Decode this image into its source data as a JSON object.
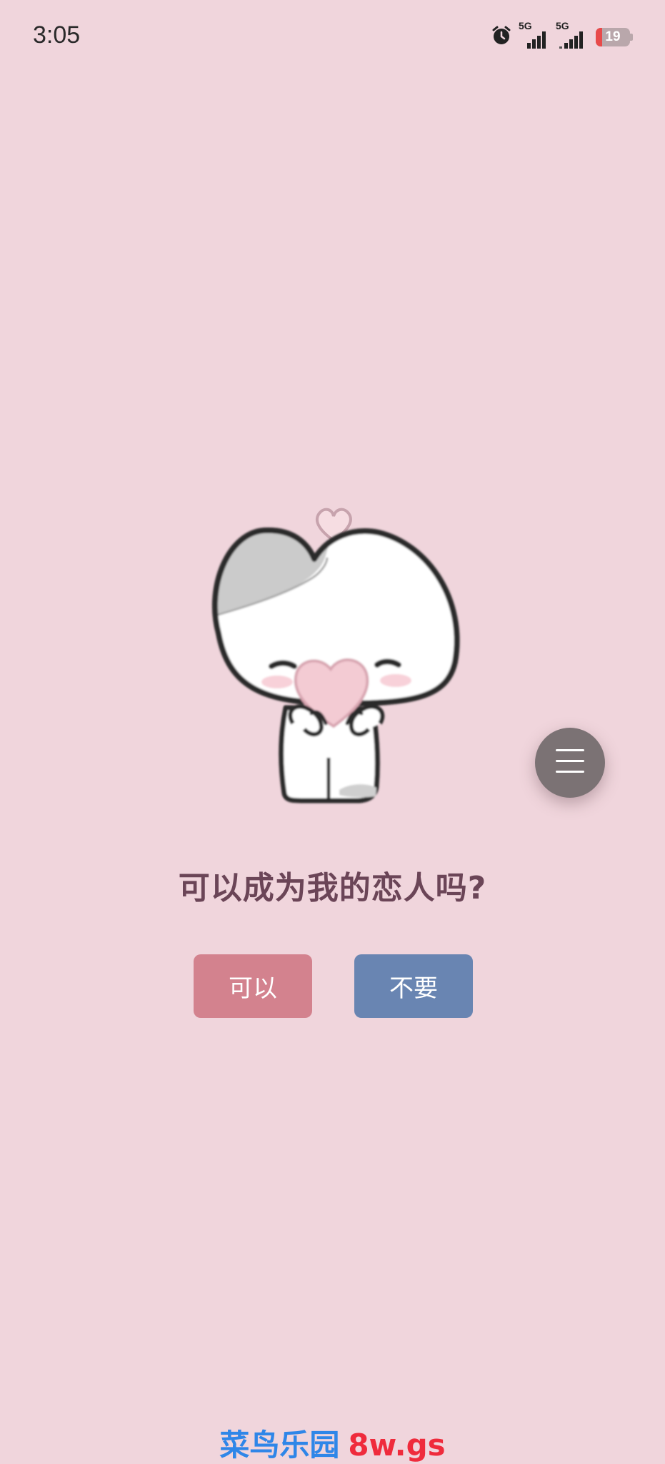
{
  "status_bar": {
    "time": "3:05",
    "network_1": "5G",
    "network_2": "5G",
    "battery_level": "19",
    "icons": [
      "alarm-icon",
      "signal-icon",
      "signal-icon",
      "battery-icon"
    ]
  },
  "illustration": {
    "icon": "character-holding-heart"
  },
  "menu_button": {
    "icon": "hamburger-icon"
  },
  "main": {
    "question": "可以成为我的恋人吗?",
    "yes_label": "可以",
    "no_label": "不要"
  },
  "footer": {
    "site_name": "菜鸟乐园",
    "domain": "8w.gs"
  },
  "colors": {
    "background": "#f0d5dc",
    "question_text": "#6b4557",
    "yes_button": "#d3828e",
    "no_button": "#6985b2",
    "menu_button": "#7b7274",
    "footer_cn": "#2f86e8",
    "footer_domain": "#ef2b3c"
  }
}
